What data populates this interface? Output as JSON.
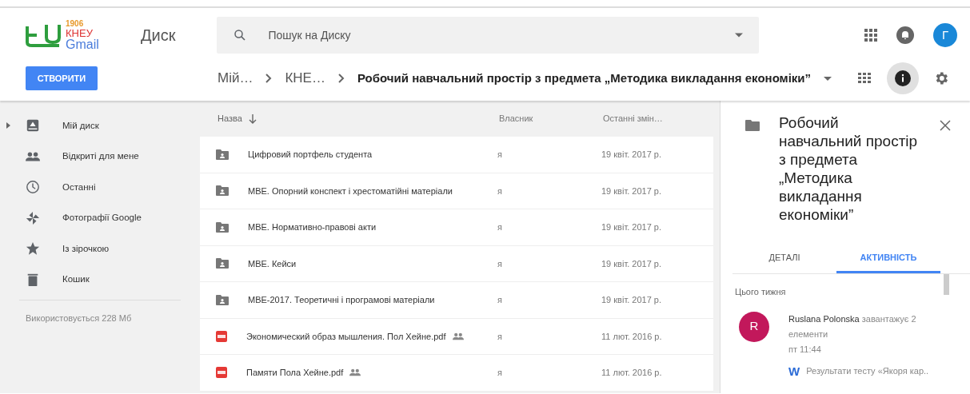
{
  "logo": {
    "year": "1906",
    "org": "КНЕУ",
    "mail": "Gmail"
  },
  "app_title": "Диск",
  "search": {
    "placeholder": "Пошук на Диску"
  },
  "account": {
    "initial": "Г"
  },
  "create_button": "СТВОРИТИ",
  "breadcrumb": [
    {
      "label": "Мій…",
      "current": false
    },
    {
      "label": "КНЕ…",
      "current": false
    },
    {
      "label": "Робочий навчальний простір з предмета „Методика викладання економіки”",
      "current": true
    }
  ],
  "toolbar": {
    "details_on": true
  },
  "sidebar": {
    "items": [
      {
        "label": "Мій диск",
        "kind": "drive",
        "expandable": true
      },
      {
        "label": "Відкриті для мене",
        "kind": "shared",
        "expandable": false
      },
      {
        "label": "Останні",
        "kind": "recent",
        "expandable": false
      },
      {
        "label": "Фотографії Google",
        "kind": "photos",
        "expandable": false
      },
      {
        "label": "Із зірочкою",
        "kind": "starred",
        "expandable": false
      },
      {
        "label": "Кошик",
        "kind": "trash",
        "expandable": false
      }
    ],
    "storage": "Використовується 228 Мб"
  },
  "table": {
    "columns": [
      "Назва",
      "Власник",
      "Останні змін…"
    ],
    "rows": [
      {
        "name": "Цифровий портфель студента",
        "kind": "folder",
        "shared": false,
        "owner": "я",
        "modified": "19 квіт. 2017 р."
      },
      {
        "name": "МВЕ. Опорний конспект і хрестоматійні матеріали",
        "kind": "folder",
        "shared": false,
        "owner": "я",
        "modified": "19 квіт. 2017 р."
      },
      {
        "name": "МВЕ. Нормативно-правові акти",
        "kind": "folder",
        "shared": false,
        "owner": "я",
        "modified": "19 квіт. 2017 р."
      },
      {
        "name": "МВЕ. Кейси",
        "kind": "folder",
        "shared": false,
        "owner": "я",
        "modified": "19 квіт. 2017 р."
      },
      {
        "name": "МВЕ-2017. Теоретичні і програмові матеріали",
        "kind": "folder",
        "shared": false,
        "owner": "я",
        "modified": "19 квіт. 2017 р."
      },
      {
        "name": "Экономический образ мышления. Пол Хейне.pdf",
        "kind": "pdf",
        "shared": true,
        "owner": "я",
        "modified": "11 лют. 2016 р."
      },
      {
        "name": "Памяти Пола Хейне.pdf",
        "kind": "pdf",
        "shared": true,
        "owner": "я",
        "modified": "11 лют. 2016 р."
      }
    ]
  },
  "details": {
    "title": "Робочий навчальний простір з предмета „Методика викладання економіки”",
    "tabs": [
      {
        "label": "ДЕТАЛІ",
        "selected": false
      },
      {
        "label": "АКТИВНІСТЬ",
        "selected": true
      }
    ],
    "section": "Цього тижня",
    "activity": {
      "initial": "R",
      "text": "**Ruslana Polonska** завантажує 2 елементи",
      "time": "пт 11:44",
      "file_icon": "W",
      "file": "Результати тесту «Якоря кар.."
    }
  }
}
